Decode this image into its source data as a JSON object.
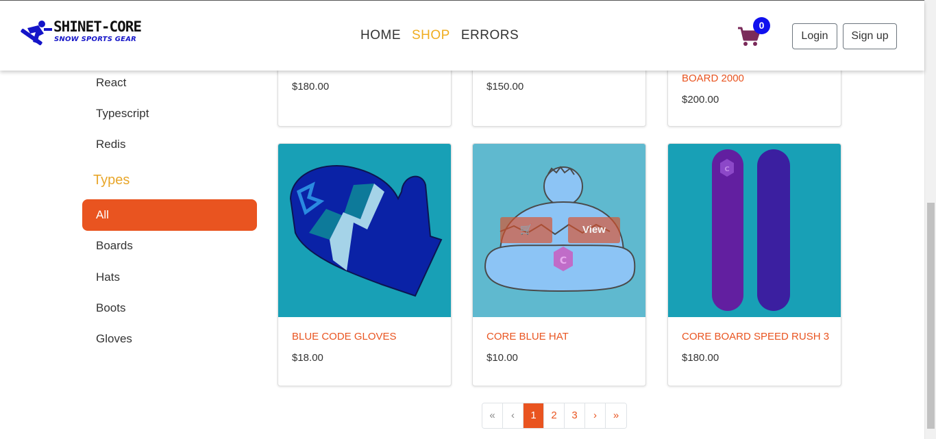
{
  "brand": {
    "title": "SHINET-CORE",
    "subtitle": "SNOW SPORTS GEAR"
  },
  "nav": {
    "home": "HOME",
    "shop": "SHOP",
    "errors": "ERRORS"
  },
  "cart": {
    "count": "0"
  },
  "auth": {
    "login": "Login",
    "signup": "Sign up"
  },
  "sidebar": {
    "brands": [
      "React",
      "Typescript",
      "Redis"
    ],
    "types_heading": "Types",
    "types": [
      "All",
      "Boards",
      "Hats",
      "Boots",
      "Gloves"
    ]
  },
  "products_top": [
    {
      "name": "",
      "price": "$180.00"
    },
    {
      "name": "",
      "price": "$150.00"
    },
    {
      "name": "BOARD 2000",
      "price": "$200.00"
    }
  ],
  "products": [
    {
      "name": "BLUE CODE GLOVES",
      "price": "$18.00"
    },
    {
      "name": "CORE BLUE HAT",
      "price": "$10.00",
      "overlay_view": "View"
    },
    {
      "name": "CORE BOARD SPEED RUSH 3",
      "price": "$180.00"
    }
  ],
  "pagination": [
    "«",
    "‹",
    "1",
    "2",
    "3",
    "›",
    "»"
  ],
  "colors": {
    "accent": "#e95420",
    "shop_active": "#f0ad1f",
    "cart_badge": "#1010ee",
    "card_bg": "#18a0b6"
  },
  "icons": [
    "snowboarder-logo-icon",
    "cart-icon"
  ]
}
